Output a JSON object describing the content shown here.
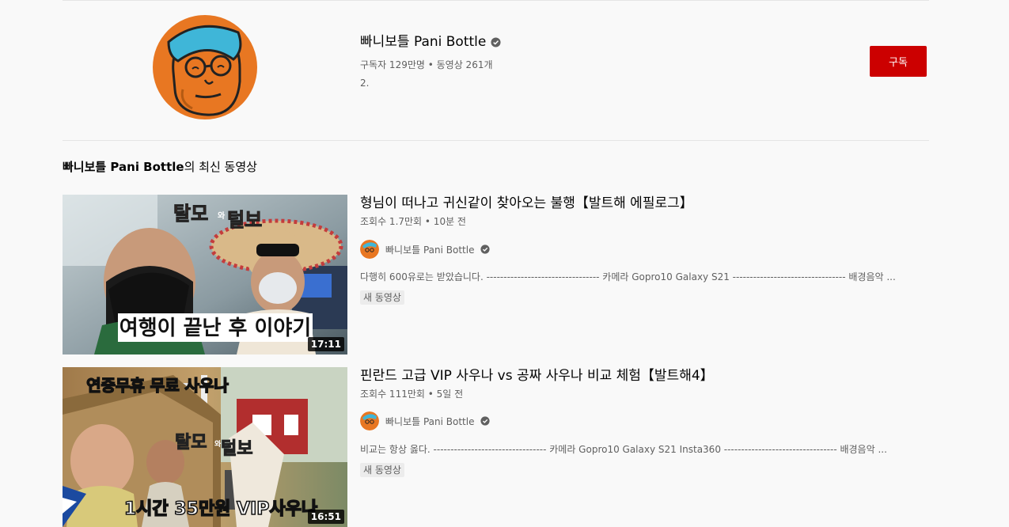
{
  "channel": {
    "name": "빠니보틀 Pani Bottle",
    "meta": "구독자 129만명 • 동영상 261개",
    "description": "2.",
    "subscribe_label": "구독"
  },
  "section": {
    "title_channel": "빠니보틀 Pani Bottle",
    "title_suffix": "의 최신 동영상"
  },
  "videos": [
    {
      "title": "형님이 떠나고 귀신같이 찾아오는 불행【발트해 에필로그】",
      "meta": "조회수 1.7만회 • 10분 전",
      "channel": "빠니보틀 Pani Bottle",
      "description": "다행히 600유로는 받았습니다. --------------------------------- 카메라 Gopro10 Galaxy S21 --------------------------------- 배경음악 ...",
      "badge": "새 동영상",
      "duration": "17:11",
      "thumb_caption": "여행이 끝난 후 이야기",
      "thumb_logo_a": "탈모",
      "thumb_logo_b": "와",
      "thumb_logo_c": "털보"
    },
    {
      "title": "핀란드 고급 VIP 사우나 vs 공짜 사우나 비교 체험【발트해4】",
      "meta": "조회수 111만회 • 5일 전",
      "channel": "빠니보틀 Pani Bottle",
      "description": "비교는 항상 옳다. --------------------------------- 카메라 Gopro10 Galaxy S21 Insta360 --------------------------------- 배경음악 ...",
      "badge": "새 동영상",
      "duration": "16:51",
      "thumb_caption_top": "연중무휴 무료 사우나",
      "thumb_caption": "1시간 35만원 VIP사우나",
      "thumb_logo_a": "탈모",
      "thumb_logo_b": "와",
      "thumb_logo_c": "털보"
    }
  ],
  "colors": {
    "subscribe_bg": "#cc0000",
    "avatar_bg": "#e87722",
    "cap_blue": "#3fb6d8"
  }
}
